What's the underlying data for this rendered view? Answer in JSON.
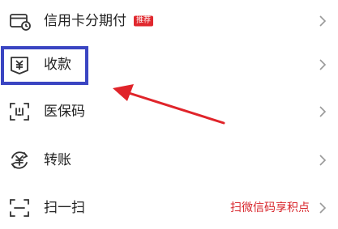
{
  "colors": {
    "text": "#222222",
    "icon_stroke": "#333333",
    "chevron": "#999999",
    "badge_bg": "#e0282e",
    "accent_red": "#d8262c",
    "highlight_border": "#3a45c2",
    "arrow": "#e0242a"
  },
  "menu": {
    "items": [
      {
        "id": "credit-installment",
        "icon": "credit-card-clock-icon",
        "label": "信用卡分期付",
        "badge": "推荐"
      },
      {
        "id": "receive-money",
        "icon": "yuan-receipt-icon",
        "label": "收款",
        "highlighted": true
      },
      {
        "id": "medical-code",
        "icon": "scan-frame-icon",
        "label": "医保码"
      },
      {
        "id": "transfer",
        "icon": "yuan-transfer-icon",
        "label": "转账"
      },
      {
        "id": "scan",
        "icon": "scan-icon",
        "label": "扫一扫",
        "trailing": "扫微信码享积点"
      }
    ]
  },
  "annotation": {
    "arrow_icon": "red-arrow-icon"
  }
}
